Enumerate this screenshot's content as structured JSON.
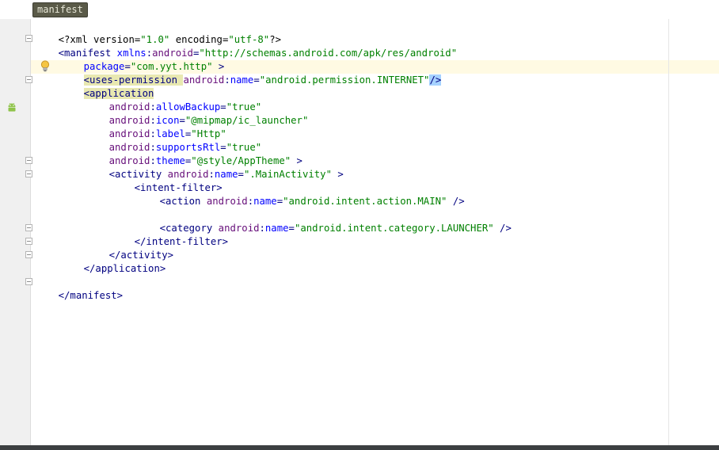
{
  "breadcrumb": {
    "label": "manifest"
  },
  "code": {
    "l1": [
      "<?xml version=",
      "\"1.0\"",
      " encoding=",
      "\"utf-8\"",
      "?>"
    ],
    "l2": [
      "<manifest ",
      "xmlns",
      ":",
      "android",
      "=",
      "\"http://schemas.android.com/apk/res/android\""
    ],
    "l3": [
      "package",
      "=",
      "\"com.yyt.http\"",
      " >"
    ],
    "l4": [
      "<uses-permission ",
      "android",
      ":",
      "name",
      "=",
      "\"android.permission.INTERNET\"",
      "/>"
    ],
    "l5": [
      "<application"
    ],
    "l6": [
      "android",
      ":",
      "allowBackup",
      "=",
      "\"true\""
    ],
    "l7": [
      "android",
      ":",
      "icon",
      "=",
      "\"@mipmap/ic_launcher\""
    ],
    "l8": [
      "android",
      ":",
      "label",
      "=",
      "\"Http\""
    ],
    "l9": [
      "android",
      ":",
      "supportsRtl",
      "=",
      "\"true\""
    ],
    "l10": [
      "android",
      ":",
      "theme",
      "=",
      "\"@style/AppTheme\"",
      " >"
    ],
    "l11": [
      "<activity ",
      "android",
      ":",
      "name",
      "=",
      "\".MainActivity\"",
      " >"
    ],
    "l12": [
      "<intent-filter>"
    ],
    "l13": [
      "<action ",
      "android",
      ":",
      "name",
      "=",
      "\"android.intent.action.MAIN\"",
      " />"
    ],
    "l15": [
      "<category ",
      "android",
      ":",
      "name",
      "=",
      "\"android.intent.category.LAUNCHER\"",
      " />"
    ],
    "l16": [
      "</intent-filter>"
    ],
    "l17": [
      "</activity>"
    ],
    "l18": [
      "</application>"
    ],
    "l20": [
      "</manifest>"
    ]
  },
  "icons": {
    "intention": "lightbulb-icon",
    "android": "android-icon"
  },
  "colors": {
    "tag": "#000080",
    "attribute": "#0000ff",
    "namespace": "#660e7a",
    "string": "#008000",
    "caret_line": "#fffae3"
  }
}
